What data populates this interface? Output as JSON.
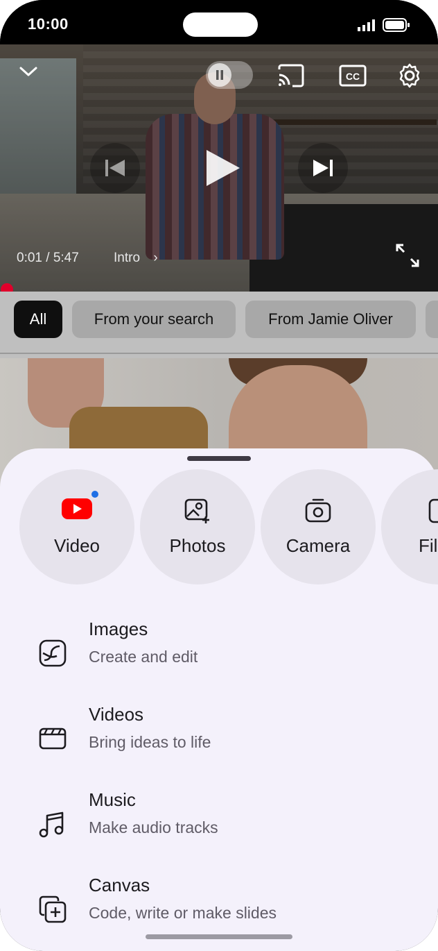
{
  "status_bar": {
    "time": "10:00"
  },
  "player": {
    "timecode": "0:01 / 5:47",
    "chapter": "Intro",
    "icons": [
      "chevron-down-icon",
      "pause-icon",
      "cast-icon",
      "closed-captions-icon",
      "settings-icon",
      "previous-icon",
      "play-icon",
      "next-icon",
      "fullscreen-icon"
    ],
    "progress_color": "#e0002b"
  },
  "chips": [
    {
      "label": "All",
      "active": true
    },
    {
      "label": "From your search",
      "active": false
    },
    {
      "label": "From Jamie Oliver",
      "active": false
    }
  ],
  "sheet": {
    "tiles": [
      {
        "label": "Video",
        "icon": "youtube-icon",
        "badge": true
      },
      {
        "label": "Photos",
        "icon": "add-photo-icon"
      },
      {
        "label": "Camera",
        "icon": "camera-icon"
      },
      {
        "label": "Fil",
        "icon": "file-icon"
      }
    ],
    "rows": [
      {
        "title": "Images",
        "subtitle": "Create and edit",
        "icon": "image-edit-icon"
      },
      {
        "title": "Videos",
        "subtitle": "Bring ideas to life",
        "icon": "clapperboard-icon"
      },
      {
        "title": "Music",
        "subtitle": "Make audio tracks",
        "icon": "music-note-icon"
      },
      {
        "title": "Canvas",
        "subtitle": "Code, write or make slides",
        "icon": "canvas-add-icon"
      }
    ],
    "accent": "#1f6fe5",
    "youtube_red": "#ff0000"
  }
}
